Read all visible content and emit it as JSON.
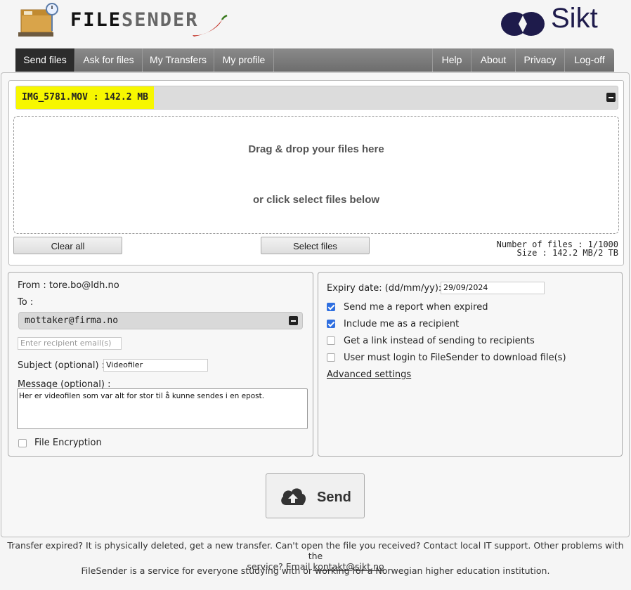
{
  "header": {
    "logo_text_a": "FILE",
    "logo_text_b": "SENDER",
    "partner_logo": "Sikt"
  },
  "nav": {
    "left": [
      "Send files",
      "Ask for files",
      "My Transfers",
      "My profile"
    ],
    "right": [
      "Help",
      "About",
      "Privacy",
      "Log-off"
    ],
    "active": "Send files"
  },
  "upload": {
    "file_item": "IMG_5781.MOV : 142.2 MB",
    "drop_line1": "Drag & drop your files here",
    "drop_line2": "or click select files below",
    "clear_label": "Clear all",
    "select_label": "Select files",
    "num_files": "Number of files : 1/1000",
    "size": "Size : 142.2 MB/2 TB"
  },
  "form": {
    "from": "From : tore.bo@ldh.no",
    "to_label": "To :",
    "recipient": "mottaker@firma.no",
    "recipient_placeholder": "Enter recipient email(s)",
    "subject_label": "Subject (optional) :",
    "subject_value": "Videofiler",
    "message_label": "Message (optional) :",
    "message_value": "Her er videofilen som var alt for stor til å kunne sendes i en epost.",
    "encryption_label": "File Encryption",
    "encryption_checked": false
  },
  "options": {
    "expiry_label": "Expiry date: (dd/mm/yy):",
    "expiry_value": "29/09/2024",
    "checkboxes": [
      {
        "label": "Send me a report when expired",
        "checked": true
      },
      {
        "label": "Include me as a recipient",
        "checked": true
      },
      {
        "label": "Get a link instead of sending to recipients",
        "checked": false
      },
      {
        "label": "User must login to FileSender to download file(s)",
        "checked": false
      }
    ],
    "advanced_label": "Advanced settings"
  },
  "send": {
    "label": "Send",
    "icon": "cloud-upload-icon"
  },
  "footer": {
    "line1": "Transfer expired? It is physically deleted, get a new transfer. Can't open the file you received? Contact local IT support. Other problems with the",
    "line2a": "service? Email ",
    "email": "kontakt@sikt.no",
    "line3": "FileSender is a service for everyone studying with or working for a Norwegian higher education institution."
  },
  "colors": {
    "file_highlight": "#f7f700",
    "nav_active": "#2c2c2c",
    "checkbox": "#2f6fe0"
  }
}
